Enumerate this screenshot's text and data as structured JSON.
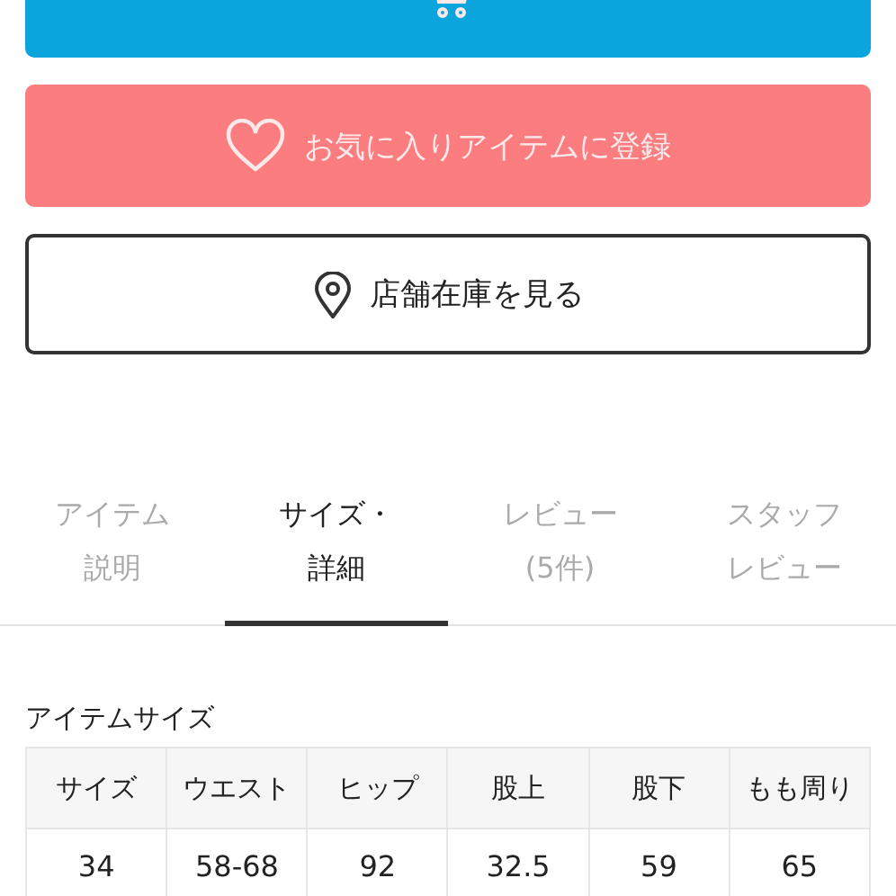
{
  "buttons": [
    {
      "kind": "cart"
    },
    {
      "kind": "favorite",
      "label": "お気に入りアイテムに登録"
    },
    {
      "kind": "store",
      "label": "店舗在庫を見る"
    }
  ],
  "tabs": [
    {
      "lines": [
        "アイテム",
        "説明"
      ],
      "selected": false
    },
    {
      "lines": [
        "サイズ・",
        "詳細"
      ],
      "selected": true
    },
    {
      "lines": [
        "レビュー",
        "(5件)"
      ],
      "selected": false
    },
    {
      "lines": [
        "スタッフ",
        "レビュー"
      ],
      "selected": false
    }
  ],
  "size_table": {
    "title": "アイテムサイズ",
    "columns": [
      "サイズ",
      "ウエスト",
      "ヒップ",
      "股上",
      "股下",
      "もも周り"
    ],
    "rows": [
      [
        "34",
        "58-68",
        "92",
        "32.5",
        "59",
        "65"
      ]
    ]
  }
}
